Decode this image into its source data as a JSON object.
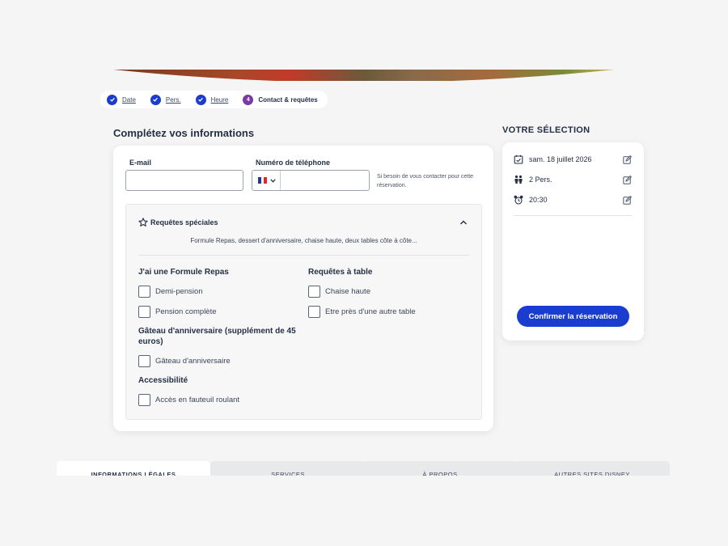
{
  "colors": {
    "primary": "#1a3dd0",
    "active_step": "#7a3aa6",
    "text": "#253045"
  },
  "steps": [
    {
      "label": "Date",
      "state": "done"
    },
    {
      "label": "Pers.",
      "state": "done"
    },
    {
      "label": "Heure",
      "state": "done"
    },
    {
      "number": "4",
      "label": "Contact & requêtes",
      "state": "active"
    }
  ],
  "form": {
    "title": "Complétez vos informations",
    "email_label": "E-mail",
    "email_value": "",
    "phone_label": "Numéro de téléphone",
    "phone_value": "",
    "phone_country": "FR",
    "phone_hint": "Si besoin de vous contacter pour cette réservation."
  },
  "requests": {
    "title": "Requêtes spéciales",
    "summary": "Formule Repas, dessert d'anniversaire, chaise haute, deux tables côte à côte...",
    "groups": {
      "formule": {
        "title": "J'ai une Formule Repas",
        "options": [
          "Demi-pension",
          "Pension complète"
        ]
      },
      "gateau": {
        "title": "Gâteau d'anniversaire (supplément de 45 euros)",
        "options": [
          "Gâteau d'anniversaire"
        ]
      },
      "accessibilite": {
        "title": "Accessibilité",
        "options": [
          "Accès en fauteuil roulant"
        ]
      },
      "table": {
        "title": "Requêtes à table",
        "options": [
          "Chaise haute",
          "Etre près d'une autre table"
        ]
      }
    }
  },
  "selection": {
    "title": "VOTRE SÉLECTION",
    "date": "sam. 18 juillet 2026",
    "persons": "2 Pers.",
    "time": "20:30",
    "confirm_label": "Confirmer la réservation"
  },
  "footer_tabs": [
    "INFORMATIONS LÉGALES",
    "SERVICES",
    "À PROPOS",
    "AUTRES SITES DISNEY"
  ]
}
